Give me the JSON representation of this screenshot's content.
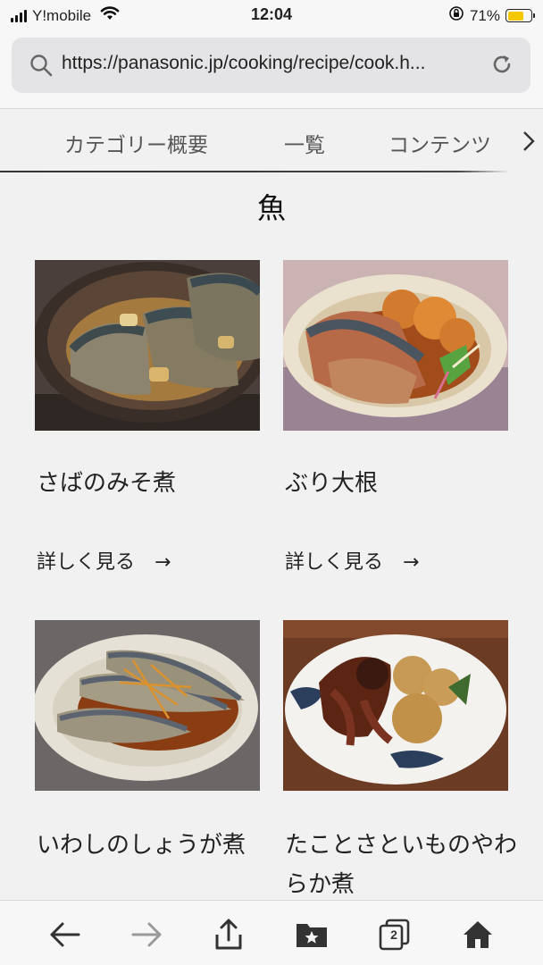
{
  "status": {
    "carrier": "Y!mobile",
    "time": "12:04",
    "battery": "71%",
    "battery_level": 0.71,
    "icons": [
      "signal-icon",
      "wifi-icon",
      "orientation-lock-icon",
      "battery-icon"
    ]
  },
  "browser": {
    "url": "https://panasonic.jp/cooking/recipe/cook.h...",
    "icons": [
      "search-icon",
      "reload-icon"
    ]
  },
  "tabs": [
    {
      "label": "カテゴリー概要"
    },
    {
      "label": "一覧"
    },
    {
      "label": "コンテンツ"
    }
  ],
  "section": {
    "title": "魚"
  },
  "recipes": [
    {
      "name": "さばのみそ煮",
      "more": "詳しく見る",
      "arrow": "→"
    },
    {
      "name": "ぶり大根",
      "more": "詳しく見る",
      "arrow": "→"
    },
    {
      "name": "いわしのしょうが煮",
      "more": "",
      "arrow": ""
    },
    {
      "name": "たことさといものやわらか煮",
      "more": "",
      "arrow": ""
    }
  ],
  "toolbar": {
    "tabs_count": "2",
    "icons": [
      "back-icon",
      "forward-icon",
      "share-icon",
      "bookmarks-icon",
      "tabs-icon",
      "home-icon"
    ]
  },
  "colors": {
    "battery": "#f5c800",
    "background": "#f2f1f2"
  }
}
